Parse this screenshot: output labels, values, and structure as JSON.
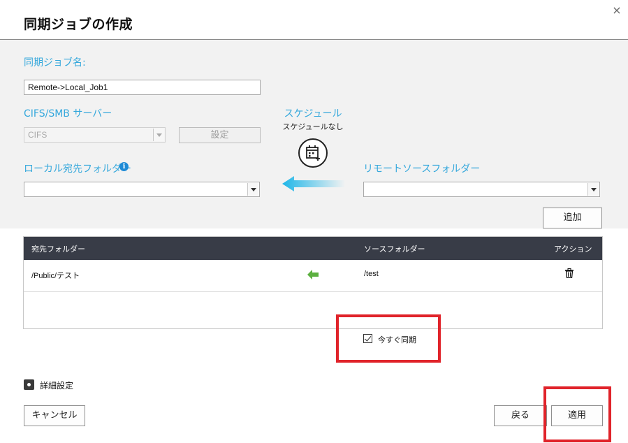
{
  "dialog": {
    "title": "同期ジョブの作成",
    "close_glyph": "×"
  },
  "job_name": {
    "label": "同期ジョブ名:",
    "value": "Remote->Local_Job1"
  },
  "server": {
    "label": "CIFS/SMB サーバー",
    "selected": "CIFS",
    "settings_button": "設定"
  },
  "schedule": {
    "label": "スケジュール",
    "status": "スケジュールなし",
    "icon": "calendar-add-icon"
  },
  "local_folder": {
    "label": "ローカル宛先フォルダー",
    "info_glyph": "i",
    "selected": ""
  },
  "remote_folder": {
    "label": "リモートソースフォルダー",
    "selected": ""
  },
  "add_button": "追加",
  "table": {
    "headers": {
      "dest": "宛先フォルダー",
      "source": "ソースフォルダー",
      "action": "アクション"
    },
    "rows": [
      {
        "dest": "/Public/テスト",
        "source": "/test",
        "action_icon": "trash-icon"
      }
    ]
  },
  "sync_now": {
    "label": "今すぐ同期",
    "checked": true
  },
  "advanced": {
    "label": "詳細設定",
    "icon": "gear-icon"
  },
  "footer": {
    "cancel": "キャンセル",
    "back": "戻る",
    "apply": "適用"
  },
  "colors": {
    "accent": "#35a8dc",
    "table_header": "#383c47",
    "highlight_red": "#e0232a",
    "row_arrow": "#5cb040"
  }
}
